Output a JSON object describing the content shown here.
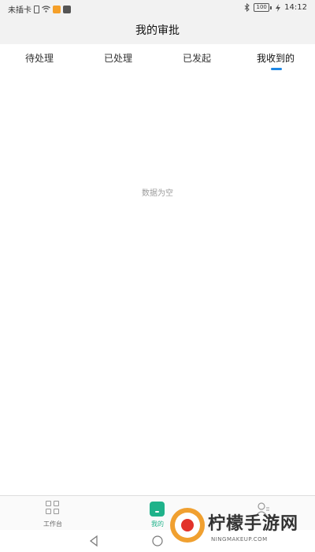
{
  "status_bar": {
    "carrier": "未插卡",
    "battery": "100",
    "time": "14:12"
  },
  "header": {
    "title": "我的审批"
  },
  "tabs": [
    {
      "label": "待处理",
      "active": false
    },
    {
      "label": "已处理",
      "active": false
    },
    {
      "label": "已发起",
      "active": false
    },
    {
      "label": "我收到的",
      "active": true
    }
  ],
  "main": {
    "empty_text": "数据为空"
  },
  "bottom_nav": {
    "items": [
      {
        "label": "工作台",
        "icon": "grid-icon",
        "active": false
      },
      {
        "label": "我的",
        "icon": "mine-icon",
        "active": true
      },
      {
        "label": "",
        "icon": "person-icon",
        "active": false
      }
    ]
  },
  "watermark": {
    "title": "柠檬手游网",
    "subtitle": "NINGMAKEUP.COM"
  },
  "colors": {
    "accent": "#1fb28a",
    "tab_indicator": "#1e88e5",
    "header_bg": "#f2f2f2",
    "empty_text": "#9b9b9b"
  }
}
